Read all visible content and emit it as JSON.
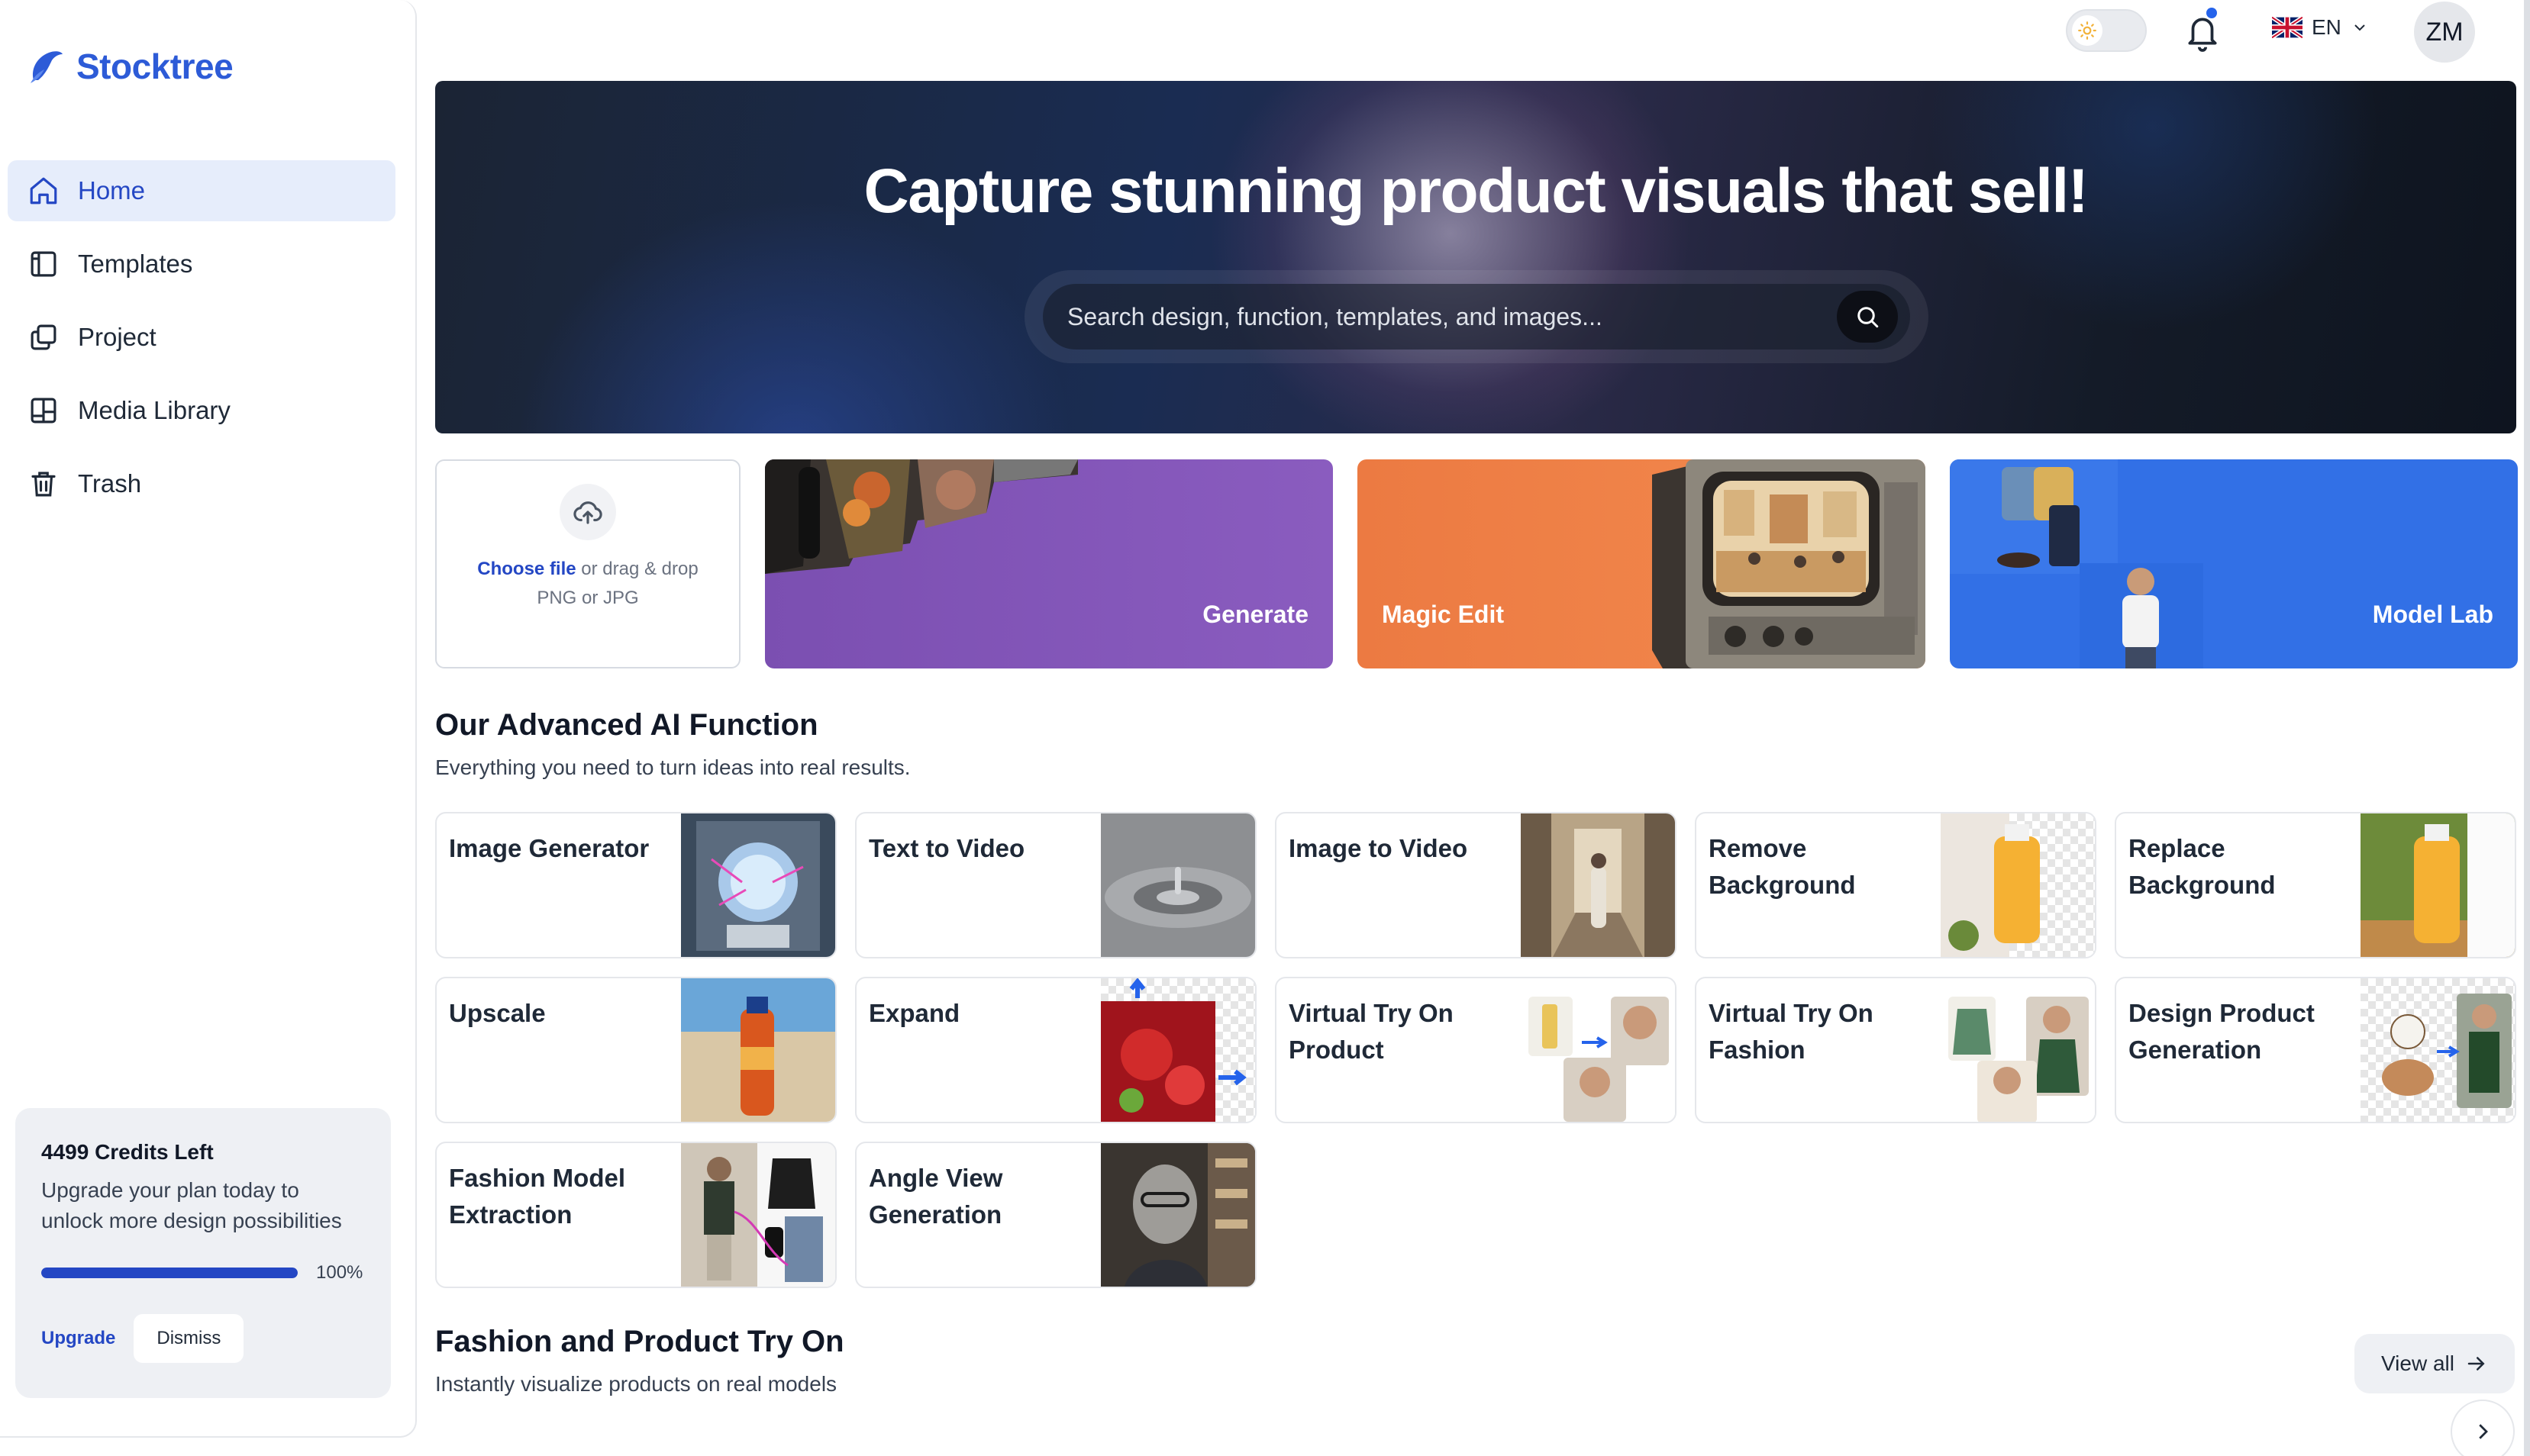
{
  "brand": {
    "name": "Stocktree",
    "accent": "#2447c4"
  },
  "nav": {
    "items": [
      {
        "label": "Home",
        "icon": "home-icon",
        "active": true
      },
      {
        "label": "Templates",
        "icon": "templates-icon",
        "active": false
      },
      {
        "label": "Project",
        "icon": "project-icon",
        "active": false
      },
      {
        "label": "Media Library",
        "icon": "media-library-icon",
        "active": false
      },
      {
        "label": "Trash",
        "icon": "trash-icon",
        "active": false
      }
    ]
  },
  "credits": {
    "title": "4499 Credits Left",
    "description": "Upgrade your plan today to unlock more design possibilities",
    "progress_percent": 100,
    "progress_label": "100%",
    "upgrade_label": "Upgrade",
    "dismiss_label": "Dismiss"
  },
  "topbar": {
    "theme_icon": "sun-icon",
    "notification_icon": "bell-icon",
    "language": "EN",
    "avatar_initials": "ZM"
  },
  "hero": {
    "title": "Capture stunning product visuals that sell!",
    "search_placeholder": "Search design, function, templates, and images..."
  },
  "upload": {
    "choose_file": "Choose file",
    "drag_text": "or drag & drop",
    "formats": "PNG or JPG"
  },
  "quick_cards": {
    "generate": "Generate",
    "magic_edit": "Magic Edit",
    "model_lab": "Model Lab"
  },
  "ai_section": {
    "title": "Our Advanced AI Function",
    "subtitle": "Everything you need to turn ideas into real results.",
    "functions": [
      "Image Generator",
      "Text to Video",
      "Image to Video",
      "Remove Background",
      "Replace Background",
      "Upscale",
      "Expand",
      "Virtual Try On Product",
      "Virtual Try On Fashion",
      "Design Product Generation",
      "Fashion Model Extraction",
      "Angle View Generation"
    ]
  },
  "tryon_section": {
    "title": "Fashion and Product Try On",
    "subtitle": "Instantly visualize products on real models",
    "view_all_label": "View all"
  }
}
